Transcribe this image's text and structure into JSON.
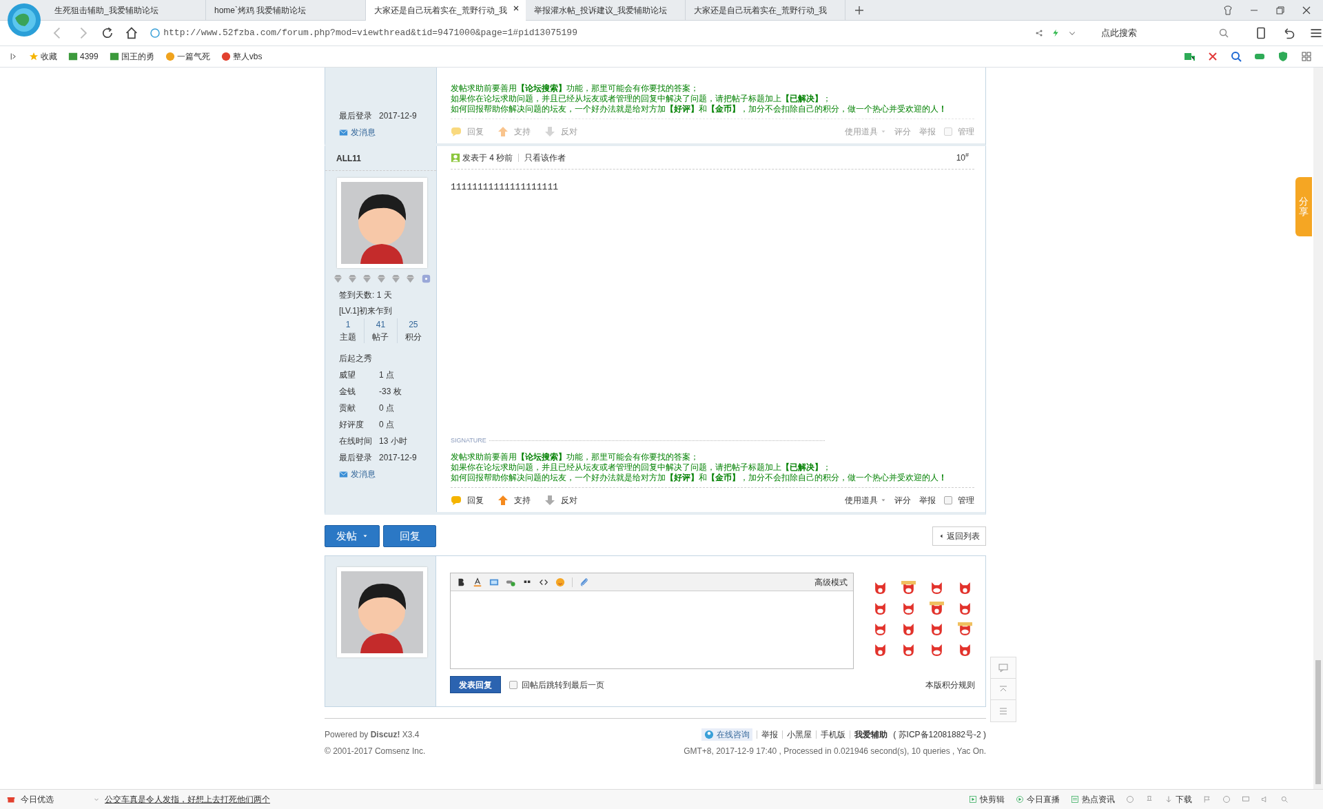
{
  "browser": {
    "tabs": [
      {
        "title": "生死狙击辅助_我爱辅助论坛",
        "selected": false
      },
      {
        "title": "home`烤鸡 我爱辅助论坛",
        "selected": false
      },
      {
        "title": "大家还是自己玩着实在_荒野行动_我",
        "selected": true
      },
      {
        "title": "举报灌水帖_投诉建议_我爱辅助论坛",
        "selected": false
      },
      {
        "title": "大家还是自己玩着实在_荒野行动_我",
        "selected": false
      }
    ],
    "url": "http://www.52fzba.com/forum.php?mod=viewthread&tid=9471000&page=1#pid13075199",
    "search_placeholder": "点此搜索",
    "bookmarks": [
      "收藏",
      "4399",
      "国王的勇",
      "一篇气死",
      "整人vbs"
    ]
  },
  "previous_post": {
    "profile": [
      {
        "label": "最后登录",
        "value": "2017-12-9"
      }
    ],
    "message_link": "发消息",
    "signature": [
      "发帖求助前要善用**【论坛搜索】**功能，那里可能会有你要找的答案；",
      "如果你在论坛求助问题，并且已经从坛友或者管理的回复中解决了问题，请把帖子标题加上**【已解决】**；",
      "如何回报帮助你解决问题的坛友，一个好办法就是给对方加**【好评】**和**【金币】**，加分不会扣除自己的积分，做一个热心并受欢迎的人**！**"
    ],
    "dimmed": true,
    "actions": {
      "left": [
        "回复",
        "支持",
        "反对"
      ],
      "tools": "使用道具",
      "right": [
        "评分",
        "举报"
      ],
      "manage": {
        "label": "管理",
        "checked": false
      }
    }
  },
  "post": {
    "author": "ALL11",
    "posted": "发表于 4 秒前",
    "author_only": "只看该作者",
    "floor": "10",
    "floor_mark": "#",
    "body": "11111111111111111111",
    "checkin": "签到天数: 1 天",
    "level": "[LV.1]初来乍到",
    "counts": [
      {
        "value": "1",
        "label": "主题"
      },
      {
        "value": "41",
        "label": "帖子"
      },
      {
        "value": "25",
        "label": "积分"
      }
    ],
    "rank": "后起之秀",
    "profile": [
      {
        "label": "威望",
        "value": "1 点"
      },
      {
        "label": "金钱",
        "value": "-33 枚"
      },
      {
        "label": "贡献",
        "value": "0 点"
      },
      {
        "label": "好评度",
        "value": "0 点"
      },
      {
        "label": "在线时间",
        "value": "13 小时"
      },
      {
        "label": "最后登录",
        "value": "2017-12-9"
      }
    ],
    "message_link": "发消息",
    "signature_label": "SIGNATURE",
    "signature": [
      "发帖求助前要善用**【论坛搜索】**功能，那里可能会有你要找的答案；",
      "如果你在论坛求助问题，并且已经从坛友或者管理的回复中解决了问题，请把帖子标题加上**【已解决】**；",
      "如何回报帮助你解决问题的坛友，一个好办法就是给对方加**【好评】**和**【金币】**，加分不会扣除自己的积分，做一个热心并受欢迎的人**！**"
    ],
    "dimmed": false,
    "actions": {
      "left": [
        "回复",
        "支持",
        "反对"
      ],
      "tools": "使用道具",
      "right": [
        "评分",
        "举报"
      ],
      "manage": {
        "label": "管理",
        "checked": false
      }
    }
  },
  "thread_buttons": {
    "new": "发帖",
    "reply": "回复",
    "back": "返回列表"
  },
  "reply_box": {
    "mode": "高级模式",
    "submit": "发表回复",
    "jump": {
      "label": "回帖后跳转到最后一页",
      "checked": false
    },
    "rules": "本版积分规则"
  },
  "footer": {
    "powered": "Powered by **Discuz!** X3.4",
    "copyright": "© 2001-2017 Comsenz Inc.",
    "consult": "在线咨询",
    "links": [
      "举报",
      "小黑屋",
      "手机版"
    ],
    "site": "我爱辅助",
    "icp": "( 苏ICP备12081882号-2 )",
    "stats": "GMT+8, 2017-12-9 17:40 , Processed in 0.021946 second(s), 10 queries , Yac On."
  },
  "share_tab": "分享",
  "status_bar": {
    "left": "今日优选",
    "news": "公交车真是令人发指，好想上去打死他们两个",
    "right": [
      "快剪辑",
      "今日直播",
      "热点资讯",
      "下载"
    ]
  }
}
